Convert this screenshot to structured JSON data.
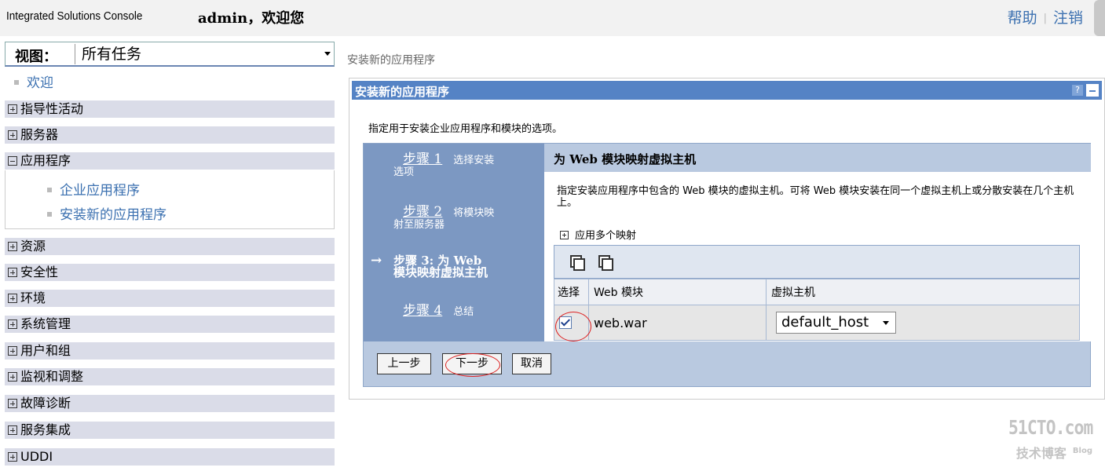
{
  "header": {
    "brand": "Integrated Solutions Console",
    "welcome": "admin，欢迎您",
    "help_link": "帮助",
    "logout_link": "注销",
    "separator": "|"
  },
  "sidebar": {
    "view_label": "视图：",
    "view_value": "所有任务",
    "welcome_link": "欢迎",
    "items": [
      {
        "label": "指导性活动",
        "expanded": false
      },
      {
        "label": "服务器",
        "expanded": false
      },
      {
        "label": "应用程序",
        "expanded": true
      },
      {
        "label": "资源",
        "expanded": false
      },
      {
        "label": "安全性",
        "expanded": false
      },
      {
        "label": "环境",
        "expanded": false
      },
      {
        "label": "系统管理",
        "expanded": false
      },
      {
        "label": "用户和组",
        "expanded": false
      },
      {
        "label": "监视和调整",
        "expanded": false
      },
      {
        "label": "故障诊断",
        "expanded": false
      },
      {
        "label": "服务集成",
        "expanded": false
      },
      {
        "label": "UDDI",
        "expanded": false
      }
    ],
    "app_children": [
      "企业应用程序",
      "安装新的应用程序"
    ]
  },
  "main": {
    "breadcrumb": "安装新的应用程序",
    "panel_title": "安装新的应用程序",
    "panel_help": "?",
    "description": "指定用于安装企业应用程序和模块的选项。",
    "steps": [
      {
        "link": "步骤 1",
        "text1": "选择安装",
        "text2": "选项"
      },
      {
        "link": "步骤 2",
        "text1": "将模块映",
        "text2": "射至服务器"
      },
      {
        "current_arrow": "→",
        "line1": "步骤 3: 为 Web",
        "line2": "模块映射虚拟主机"
      },
      {
        "link": "步骤 4",
        "text1": "总结"
      }
    ],
    "content_title": "为 Web 模块映射虚拟主机",
    "content_desc": "指定安装应用程序中包含的 Web 模块的虚拟主机。可将 Web 模块安装在同一个虚拟主机上或分散安装在几个主机上。",
    "multi_mapping": "应用多个映射",
    "table": {
      "headers": [
        "选择",
        "Web 模块",
        "虚拟主机"
      ],
      "rows": [
        {
          "checked": true,
          "module": "web.war",
          "virtual_host": "default_host"
        }
      ]
    },
    "buttons": {
      "prev": "上一步",
      "next": "下一步",
      "cancel": "取消"
    }
  },
  "watermark": {
    "line1": "51CTO.com",
    "line2": "技术博客",
    "line2b": "Blog"
  },
  "colors": {
    "panel_header": "#5583c5",
    "steps_bg": "#7c98c2",
    "nav_bg": "#dadce8",
    "link": "#3b70b0",
    "highlight_ring": "#dd2222"
  }
}
